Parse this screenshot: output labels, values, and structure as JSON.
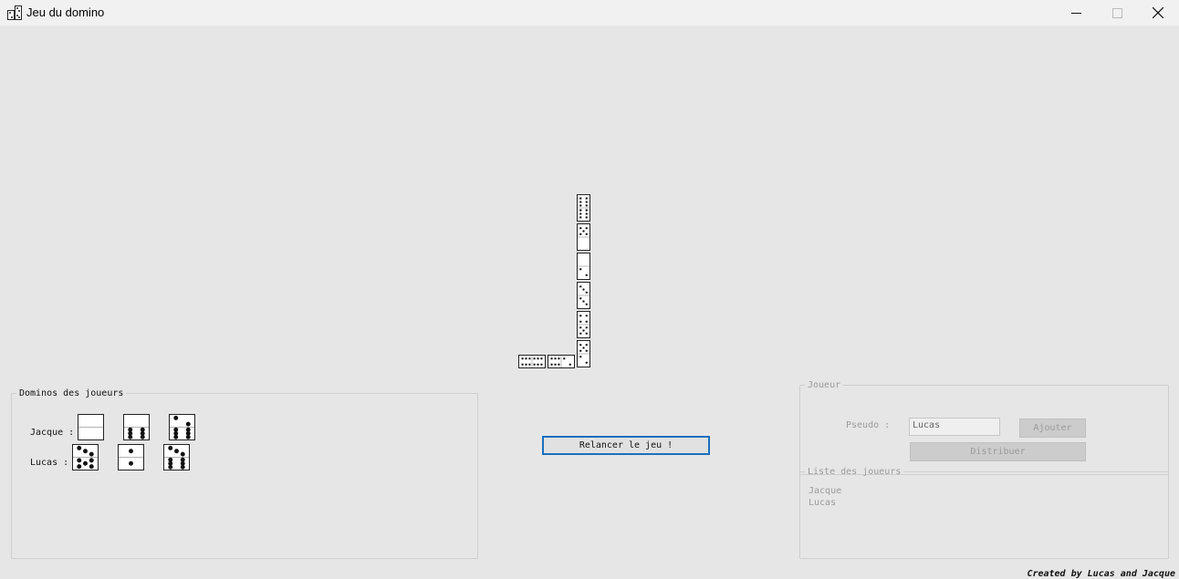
{
  "window": {
    "title": "Jeu du domino",
    "controls": [
      "minimize-icon",
      "maximize-icon",
      "close-icon"
    ]
  },
  "board": {
    "vertical_tiles": [
      [
        6,
        6
      ],
      [
        5,
        0
      ],
      [
        0,
        2
      ],
      [
        3,
        3
      ],
      [
        4,
        5
      ],
      [
        5,
        2
      ]
    ],
    "horizontal_tiles": [
      [
        6,
        6
      ],
      [
        6,
        2
      ]
    ]
  },
  "players_panel": {
    "legend": "Dominos des joueurs",
    "players": [
      {
        "label": "Jacque :",
        "tiles": [
          [
            0,
            0
          ],
          [
            0,
            6
          ],
          [
            2,
            6
          ]
        ]
      },
      {
        "label": "Lucas :",
        "tiles": [
          [
            3,
            5
          ],
          [
            1,
            1
          ],
          [
            3,
            6
          ]
        ]
      }
    ]
  },
  "center": {
    "restart_label": "Relancer le jeu !"
  },
  "joueur_panel": {
    "legend": "Joueur",
    "pseudo_label": "Pseudo :",
    "pseudo_value": "Lucas",
    "add_label": "Ajouter",
    "deal_label": "Distribuer"
  },
  "list_panel": {
    "legend": "Liste des joueurs",
    "players": [
      "Jacque",
      "Lucas"
    ]
  },
  "footer": {
    "credit": "Created by Lucas and Jacque"
  },
  "colors": {
    "accent": "#1a6fbd",
    "background": "#e6e6e6",
    "titlebar": "#f1f1f1"
  }
}
